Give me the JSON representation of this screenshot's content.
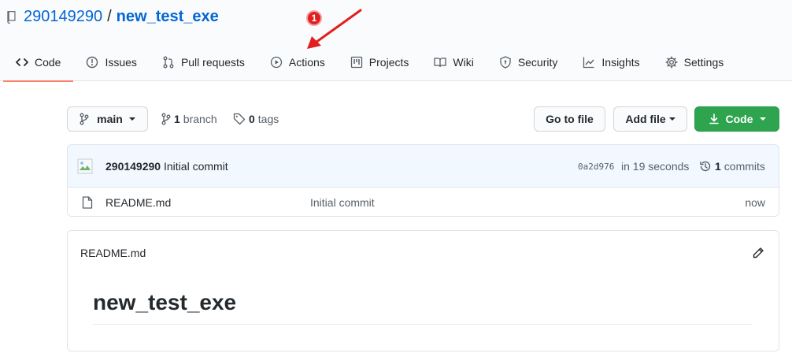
{
  "repo": {
    "owner": "290149290",
    "separator": "/",
    "name": "new_test_exe"
  },
  "tabs": [
    {
      "label": "Code",
      "icon": "code-icon",
      "active": true
    },
    {
      "label": "Issues",
      "icon": "issue-icon"
    },
    {
      "label": "Pull requests",
      "icon": "pull-request-icon"
    },
    {
      "label": "Actions",
      "icon": "play-icon"
    },
    {
      "label": "Projects",
      "icon": "project-icon"
    },
    {
      "label": "Wiki",
      "icon": "book-icon"
    },
    {
      "label": "Security",
      "icon": "shield-icon"
    },
    {
      "label": "Insights",
      "icon": "graph-icon"
    },
    {
      "label": "Settings",
      "icon": "gear-icon"
    }
  ],
  "annotation": {
    "badge": "1",
    "color": "#e02020"
  },
  "branch_bar": {
    "branch_label": "main",
    "branch_count": "1",
    "branch_word": "branch",
    "tag_count": "0",
    "tag_word": "tags",
    "go_to_file": "Go to file",
    "add_file": "Add file",
    "code": "Code"
  },
  "commit": {
    "author": "290149290",
    "message": "Initial commit",
    "sha": "0a2d976",
    "time": "in 19 seconds",
    "count": "1",
    "count_word": "commits"
  },
  "files": [
    {
      "name": "README.md",
      "commit": "Initial commit",
      "time": "now"
    }
  ],
  "readme": {
    "title": "README.md",
    "heading": "new_test_exe"
  },
  "colors": {
    "link": "#0366d6",
    "primary_button": "#2ea44f",
    "active_tab_underline": "#f9826c",
    "commit_row_bg": "#f1f8ff"
  }
}
